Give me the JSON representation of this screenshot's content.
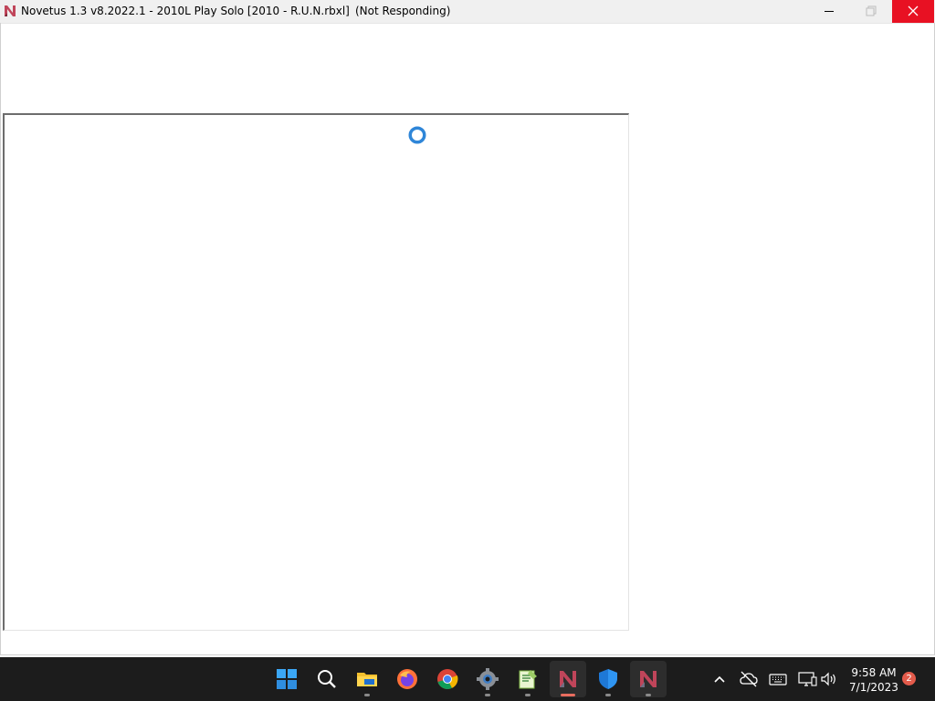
{
  "window": {
    "title": "Novetus 1.3 v8.2022.1 - 2010L Play Solo [2010 - R.U.N.rbxl]",
    "status": "(Not Responding)"
  },
  "taskbar": {
    "apps": [
      {
        "name": "start",
        "icon": "windows-start-icon"
      },
      {
        "name": "search",
        "icon": "search-icon"
      },
      {
        "name": "file-explorer",
        "icon": "folder-icon"
      },
      {
        "name": "firefox",
        "icon": "firefox-icon"
      },
      {
        "name": "chrome",
        "icon": "chrome-icon"
      },
      {
        "name": "settings",
        "icon": "gear-icon"
      },
      {
        "name": "notepad++",
        "icon": "notepad-icon"
      },
      {
        "name": "novetus",
        "icon": "novetus-icon"
      },
      {
        "name": "windows-security",
        "icon": "shield-icon"
      },
      {
        "name": "novetus-player",
        "icon": "novetus-icon"
      }
    ],
    "clock": {
      "time": "9:58 AM",
      "date": "7/1/2023"
    },
    "notifications": "2"
  },
  "colors": {
    "close_button": "#e81123",
    "taskbar_bg": "#1c1c1c",
    "accent": "#3b8ed8"
  }
}
